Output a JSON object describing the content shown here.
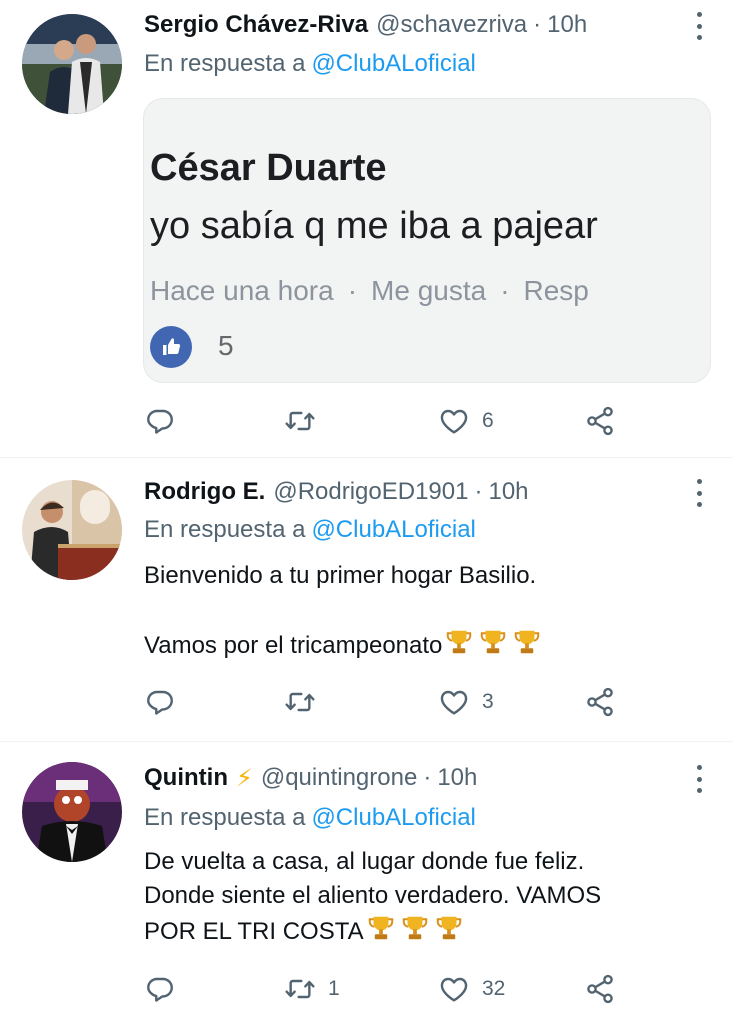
{
  "tweets": [
    {
      "name": "Sergio Chávez-Riva",
      "badge": "",
      "handle": "@schavezriva",
      "separator": "·",
      "time": "10h",
      "reply_prefix": "En respuesta a",
      "reply_mention": "@ClubALoficial",
      "text_lines": [],
      "media": {
        "name": "César Duarte",
        "comment": "yo sabía q me iba a pajear",
        "meta_time": "Hace una hora",
        "meta_sep": "·",
        "meta_like": "Me gusta",
        "meta_reply": "Resp",
        "like_count": "5"
      },
      "reply_count": "",
      "retweet_count": "",
      "like_count": "6"
    },
    {
      "name": "Rodrigo E.",
      "badge": "",
      "handle": "@RodrigoED1901",
      "separator": "·",
      "time": "10h",
      "reply_prefix": "En respuesta a",
      "reply_mention": "@ClubALoficial",
      "text_lines": [
        "Bienvenido a tu primer hogar Basilio.",
        "",
        "Vamos por el tricampeonato"
      ],
      "reply_count": "",
      "retweet_count": "",
      "like_count": "3"
    },
    {
      "name": "Quintin",
      "badge": "⚡",
      "handle": "@quintingrone",
      "separator": "·",
      "time": "10h",
      "reply_prefix": "En respuesta a",
      "reply_mention": "@ClubALoficial",
      "text_lines": [
        "De vuelta a casa, al lugar donde fue feliz.",
        "Donde siente el aliento verdadero. VAMOS",
        "POR EL TRI COSTA"
      ],
      "reply_count": "",
      "retweet_count": "1",
      "like_count": "32"
    }
  ],
  "colors": {
    "accent": "#1d9bf0",
    "secondary_text": "#536471",
    "primary_text": "#0f1419",
    "divider": "#eff3f4",
    "trophy": "#e8a317"
  },
  "icons": [
    "reply-icon",
    "retweet-icon",
    "like-icon",
    "share-icon",
    "more-icon",
    "trophy-icon",
    "lightning-icon",
    "thumbs-up-icon"
  ]
}
